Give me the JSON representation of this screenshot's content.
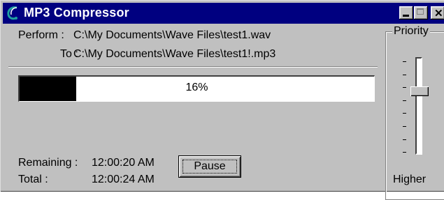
{
  "window": {
    "title": "MP3 Compressor",
    "icon": "mp3-compressor-icon",
    "buttons": [
      "minimize",
      "maximize",
      "close"
    ]
  },
  "files": {
    "perform_label": "Perform :",
    "perform_path": "C:\\My Documents\\Wave Files\\test1.wav",
    "to_label": "To :",
    "to_path": "C:\\My Documents\\Wave Files\\test1!.mp3"
  },
  "progress": {
    "value": 0.16,
    "label": "16%",
    "fill_color": "#000000"
  },
  "times": {
    "remaining_label": "Remaining :",
    "remaining_value": "12:00:20 AM",
    "total_label": "Total :",
    "total_value": "12:00:24 AM"
  },
  "actions": {
    "pause_label": "Pause"
  },
  "priority": {
    "title": "Priority",
    "value_label": "Higher",
    "level": 0.33,
    "tick_count": 8
  },
  "colors": {
    "titlebar": "#000080",
    "face": "#c0c0c0"
  }
}
